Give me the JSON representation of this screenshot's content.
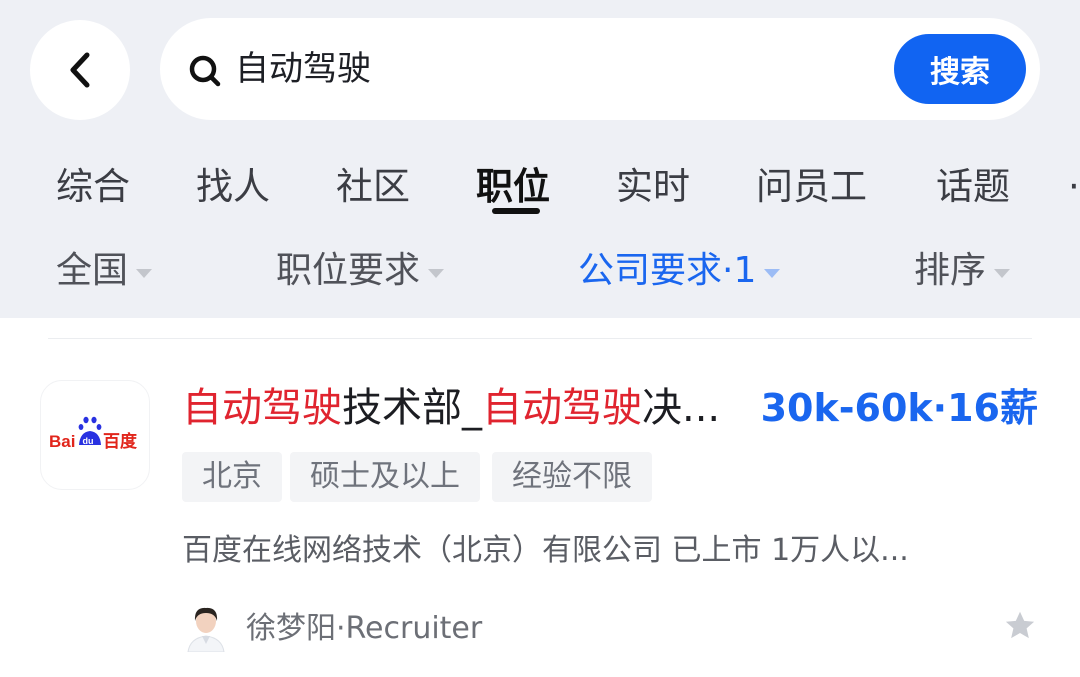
{
  "header": {
    "back_icon": "chevron-left-icon",
    "search": {
      "icon": "search-icon",
      "query": "自动驾驶",
      "button_label": "搜索",
      "button_color": "#1164f2"
    }
  },
  "tabs": [
    {
      "label": "综合"
    },
    {
      "label": "找人"
    },
    {
      "label": "社区"
    },
    {
      "label": "职位",
      "active": true
    },
    {
      "label": "实时"
    },
    {
      "label": "问员工"
    },
    {
      "label": "话题"
    }
  ],
  "filters": [
    {
      "label": "全国"
    },
    {
      "label": "职位要求"
    },
    {
      "label": "公司要求·1",
      "active": true
    },
    {
      "label": "排序"
    }
  ],
  "job": {
    "company_logo": {
      "text_bai": "Bai",
      "text_du": "du",
      "text_cn": "百度"
    },
    "title_parts": [
      "自动驾驶",
      "技术部_",
      "自动驾驶",
      "决..."
    ],
    "salary": "30k-60k·16薪",
    "tags": [
      "北京",
      "硕士及以上",
      "经验不限"
    ],
    "company_info": "百度在线网络技术（北京）有限公司 已上市 1万人以...",
    "recruiter": "徐梦阳·Recruiter",
    "favorite_icon": "star-icon"
  },
  "colors": {
    "accent": "#1a66ef",
    "highlight": "#e0242f",
    "header_bg": "#eef0f5"
  }
}
